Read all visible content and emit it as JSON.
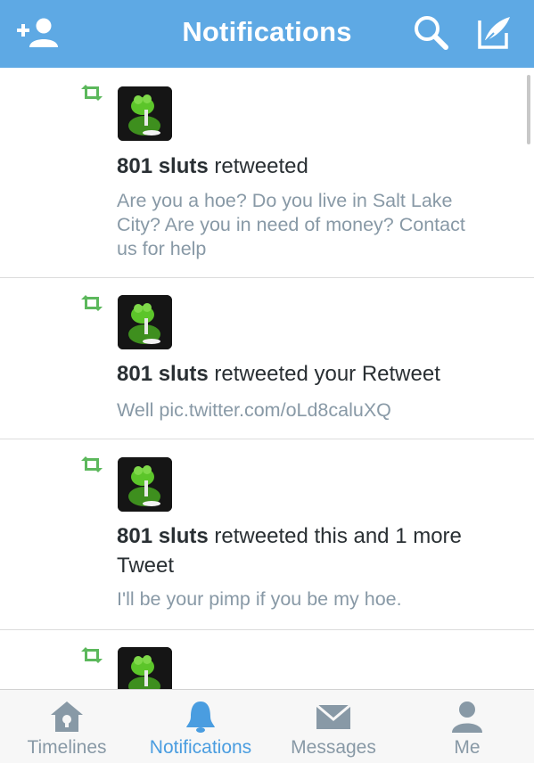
{
  "header": {
    "title": "Notifications",
    "icons": [
      "add-user-icon",
      "search-icon",
      "compose-icon"
    ]
  },
  "notifications": [
    {
      "user": "801 sluts",
      "action": "retweeted",
      "tweet": [
        "Are you a hoe? Do you live in Salt Lake",
        "City? Are you in need of money? Contact",
        "us for help"
      ]
    },
    {
      "user": "801 sluts",
      "action": "retweeted your Retweet",
      "tweet": [
        "Well pic.twitter.com/oLd8caluXQ"
      ]
    },
    {
      "user": "801 sluts",
      "action_lines": [
        "retweeted this and 1 more",
        "Tweet"
      ],
      "tweet": [
        "I'll be your pimp if you be my hoe."
      ]
    }
  ],
  "tabs": [
    {
      "label": "Timelines",
      "icon": "home-icon",
      "active": false
    },
    {
      "label": "Notifications",
      "icon": "bell-icon",
      "active": true
    },
    {
      "label": "Messages",
      "icon": "envelope-icon",
      "active": false
    },
    {
      "label": "Me",
      "icon": "person-icon",
      "active": false
    }
  ],
  "colors": {
    "header_bg": "#5ea9e4",
    "retweet_green": "#5cb85c",
    "active_tab": "#4a9de0",
    "inactive_tab": "#8899a6",
    "tweet_text": "#8899a6"
  }
}
